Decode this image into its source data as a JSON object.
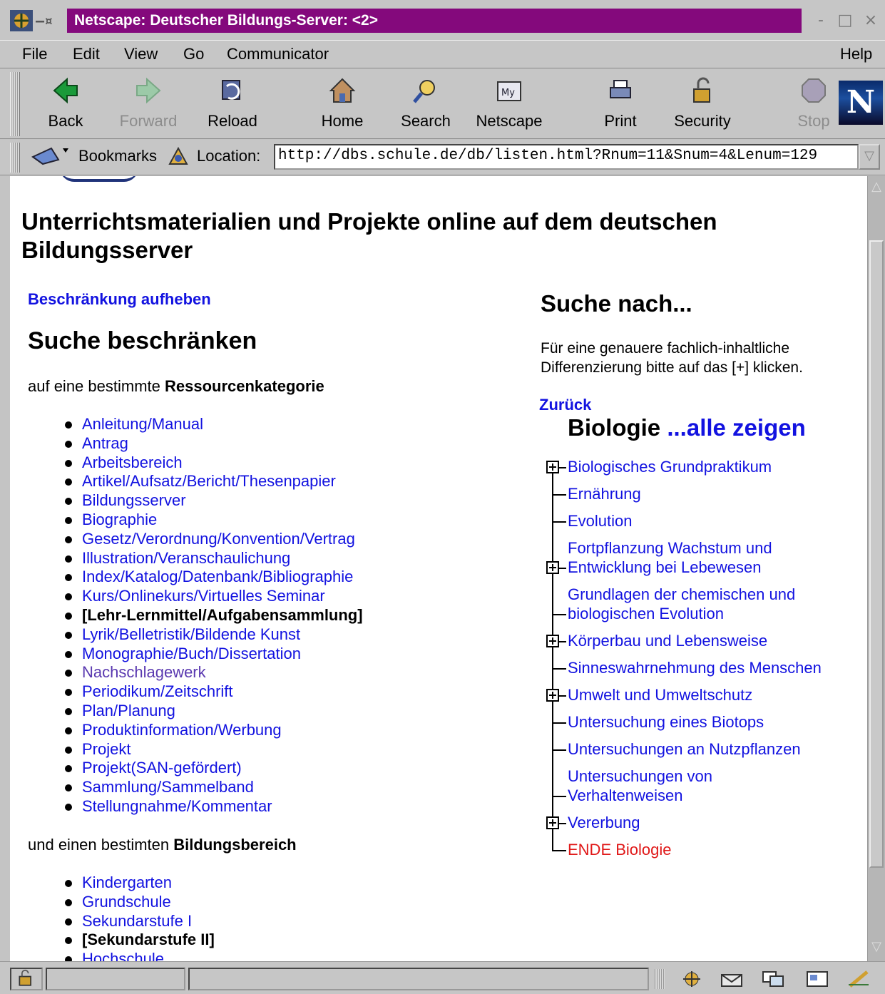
{
  "window": {
    "title": "Netscape: Deutscher Bildungs-Server: <2>",
    "buttons": [
      "-",
      "□",
      "×"
    ]
  },
  "menu": {
    "items": [
      "File",
      "Edit",
      "View",
      "Go",
      "Communicator"
    ],
    "help": "Help"
  },
  "toolbar": {
    "buttons": [
      {
        "label": "Back",
        "icon": "back-arrow-icon",
        "enabled": true
      },
      {
        "label": "Forward",
        "icon": "forward-arrow-icon",
        "enabled": false
      },
      {
        "label": "Reload",
        "icon": "reload-icon",
        "enabled": true
      },
      {
        "label": "Home",
        "icon": "home-icon",
        "enabled": true
      },
      {
        "label": "Search",
        "icon": "search-icon",
        "enabled": true
      },
      {
        "label": "Netscape",
        "icon": "my-netscape-icon",
        "enabled": true
      },
      {
        "label": "Print",
        "icon": "printer-icon",
        "enabled": true
      },
      {
        "label": "Security",
        "icon": "padlock-icon",
        "enabled": true
      },
      {
        "label": "Stop",
        "icon": "stop-icon",
        "enabled": false
      }
    ],
    "brand_logo": "N"
  },
  "location": {
    "bookmarks_label": "Bookmarks",
    "location_label": "Location:",
    "url": "http://dbs.schule.de/db/listen.html?Rnum=11&Snum=4&Lenum=129"
  },
  "page": {
    "title": "Unterrichtsmaterialien und Projekte online auf dem deutschen Bildungsserver",
    "reset_link": "Beschränkung aufheben",
    "restrict_heading": "Suche beschränken",
    "category_intro_prefix": "auf eine bestimmte ",
    "category_intro_bold": "Ressourcenkategorie",
    "categories": [
      {
        "label": "Anleitung/Manual",
        "state": "link"
      },
      {
        "label": "Antrag",
        "state": "link"
      },
      {
        "label": "Arbeitsbereich",
        "state": "link"
      },
      {
        "label": "Artikel/Aufsatz/Bericht/Thesenpapier",
        "state": "link"
      },
      {
        "label": "Bildungsserver",
        "state": "link"
      },
      {
        "label": "Biographie",
        "state": "link"
      },
      {
        "label": "Gesetz/Verordnung/Konvention/Vertrag",
        "state": "link"
      },
      {
        "label": "Illustration/Veranschaulichung",
        "state": "link"
      },
      {
        "label": "Index/Katalog/Datenbank/Bibliographie",
        "state": "link"
      },
      {
        "label": "Kurs/Onlinekurs/Virtuelles Seminar",
        "state": "link"
      },
      {
        "label": "[Lehr-Lernmittel/Aufgabensammlung]",
        "state": "current"
      },
      {
        "label": "Lyrik/Belletristik/Bildende Kunst",
        "state": "link"
      },
      {
        "label": "Monographie/Buch/Dissertation",
        "state": "link"
      },
      {
        "label": "Nachschlagewerk",
        "state": "visited"
      },
      {
        "label": "Periodikum/Zeitschrift",
        "state": "link"
      },
      {
        "label": "Plan/Planung",
        "state": "link"
      },
      {
        "label": "Produktinformation/Werbung",
        "state": "link"
      },
      {
        "label": "Projekt",
        "state": "link"
      },
      {
        "label": "Projekt(SAN-gefördert)",
        "state": "link"
      },
      {
        "label": "Sammlung/Sammelband",
        "state": "link"
      },
      {
        "label": "Stellungnahme/Kommentar",
        "state": "link"
      }
    ],
    "level_intro_prefix": "und einen bestimten ",
    "level_intro_bold": "Bildungsbereich",
    "levels": [
      {
        "label": "Kindergarten",
        "state": "link"
      },
      {
        "label": "Grundschule",
        "state": "link"
      },
      {
        "label": "Sekundarstufe I",
        "state": "link"
      },
      {
        "label": "[Sekundarstufe II]",
        "state": "current"
      },
      {
        "label": "Hochschule",
        "state": "link"
      }
    ],
    "search_heading": "Suche nach...",
    "search_hint": "Für eine genauere fachlich-inhaltliche Differenzierung bitte auf das [+] klicken.",
    "back_link": "Zurück",
    "subject": "Biologie",
    "show_all": "...alle zeigen",
    "tree": [
      {
        "lines": [
          "Biologisches Grundpraktikum"
        ],
        "expandable": true
      },
      {
        "lines": [
          "Ernährung"
        ],
        "expandable": false
      },
      {
        "lines": [
          "Evolution"
        ],
        "expandable": false
      },
      {
        "lines": [
          "Fortpflanzung Wachstum und",
          "Entwicklung bei Lebewesen"
        ],
        "expandable": true
      },
      {
        "lines": [
          "Grundlagen der chemischen und",
          "biologischen Evolution"
        ],
        "expandable": false
      },
      {
        "lines": [
          "Körperbau und Lebensweise"
        ],
        "expandable": true
      },
      {
        "lines": [
          "Sinneswahrnehmung des Menschen"
        ],
        "expandable": false
      },
      {
        "lines": [
          "Umwelt und Umweltschutz"
        ],
        "expandable": true
      },
      {
        "lines": [
          "Untersuchung eines Biotops"
        ],
        "expandable": false
      },
      {
        "lines": [
          "Untersuchungen an Nutzpflanzen"
        ],
        "expandable": false
      },
      {
        "lines": [
          "Untersuchungen von",
          "Verhaltenweisen"
        ],
        "expandable": false
      },
      {
        "lines": [
          "Vererbung"
        ],
        "expandable": true
      },
      {
        "lines": [
          "ENDE Biologie"
        ],
        "expandable": false,
        "end": true
      }
    ]
  },
  "colors": {
    "titlebar": "#84097c",
    "link": "#1212e0",
    "visited": "#5a39b0",
    "end_marker": "#e01818"
  }
}
